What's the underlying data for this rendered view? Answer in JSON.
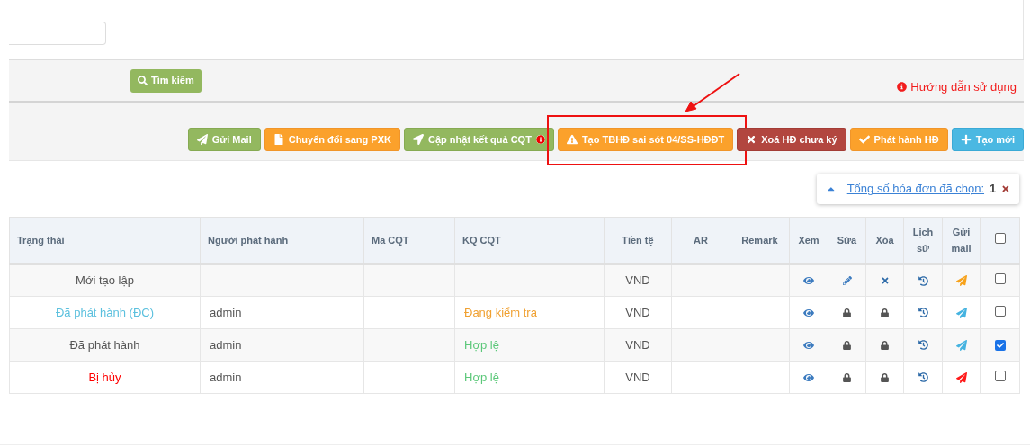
{
  "search_button": {
    "label": "Tìm kiếm"
  },
  "help_link": {
    "label": "Hướng dẫn sử dụng"
  },
  "toolbar": [
    {
      "label": "Gửi Mail",
      "kind": "send",
      "info": false,
      "highlighted": false
    },
    {
      "label": "Chuyển đổi sang PXK",
      "kind": "file",
      "info": false,
      "highlighted": false
    },
    {
      "label": "Cập nhật kết quả CQT",
      "kind": "update",
      "info": true,
      "highlighted": false
    },
    {
      "label": "Tạo TBHĐ sai sót 04/SS-HĐĐT",
      "kind": "warning",
      "info": false,
      "highlighted": true
    },
    {
      "label": "Xoá HĐ chưa ký",
      "kind": "delete",
      "info": false,
      "highlighted": false
    },
    {
      "label": "Phát hành HĐ",
      "kind": "publish",
      "info": false,
      "highlighted": false
    },
    {
      "label": "Tạo mới",
      "kind": "create",
      "info": false,
      "highlighted": false
    }
  ],
  "selection_summary": {
    "label": "Tổng số hóa đơn đã chọn:",
    "count": "1"
  },
  "table": {
    "columns": [
      "Trạng thái",
      "Người phát hành",
      "Mã CQT",
      "KQ CQT",
      "Tiền tệ",
      "AR",
      "Remark",
      "Xem",
      "Sửa",
      "Xóa",
      "Lịch sử",
      "Gửi mail"
    ],
    "select_all": {
      "checked": false
    },
    "rows": [
      {
        "status": {
          "label": "Mới tạo lập",
          "color": "#555555"
        },
        "currency": "VND",
        "locked": false,
        "mail": {
          "color": "#f7a21b"
        },
        "checked": false
      },
      {
        "status": {
          "label": "Đã phát hành (ĐC)",
          "color": "#5bc0de"
        },
        "issuer": "admin",
        "result": {
          "label": "Đang kiểm tra",
          "color": "#f0a030"
        },
        "currency": "VND",
        "locked": true,
        "mail": {
          "color": "#45b3e0"
        },
        "checked": false
      },
      {
        "status": {
          "label": "Đã phát hành",
          "color": "#555555"
        },
        "issuer": "admin",
        "result": {
          "label": "Hợp lệ",
          "color": "#5cc87a"
        },
        "currency": "VND",
        "locked": true,
        "mail": {
          "color": "#45b3e0"
        },
        "checked": true
      },
      {
        "status": {
          "label": "Bị hủy",
          "color": "#ff0000"
        },
        "issuer": "admin",
        "result": {
          "label": "Hợp lệ",
          "color": "#5cc87a"
        },
        "currency": "VND",
        "locked": true,
        "mail": {
          "color": "#ff1a1a"
        },
        "checked": false
      }
    ]
  }
}
